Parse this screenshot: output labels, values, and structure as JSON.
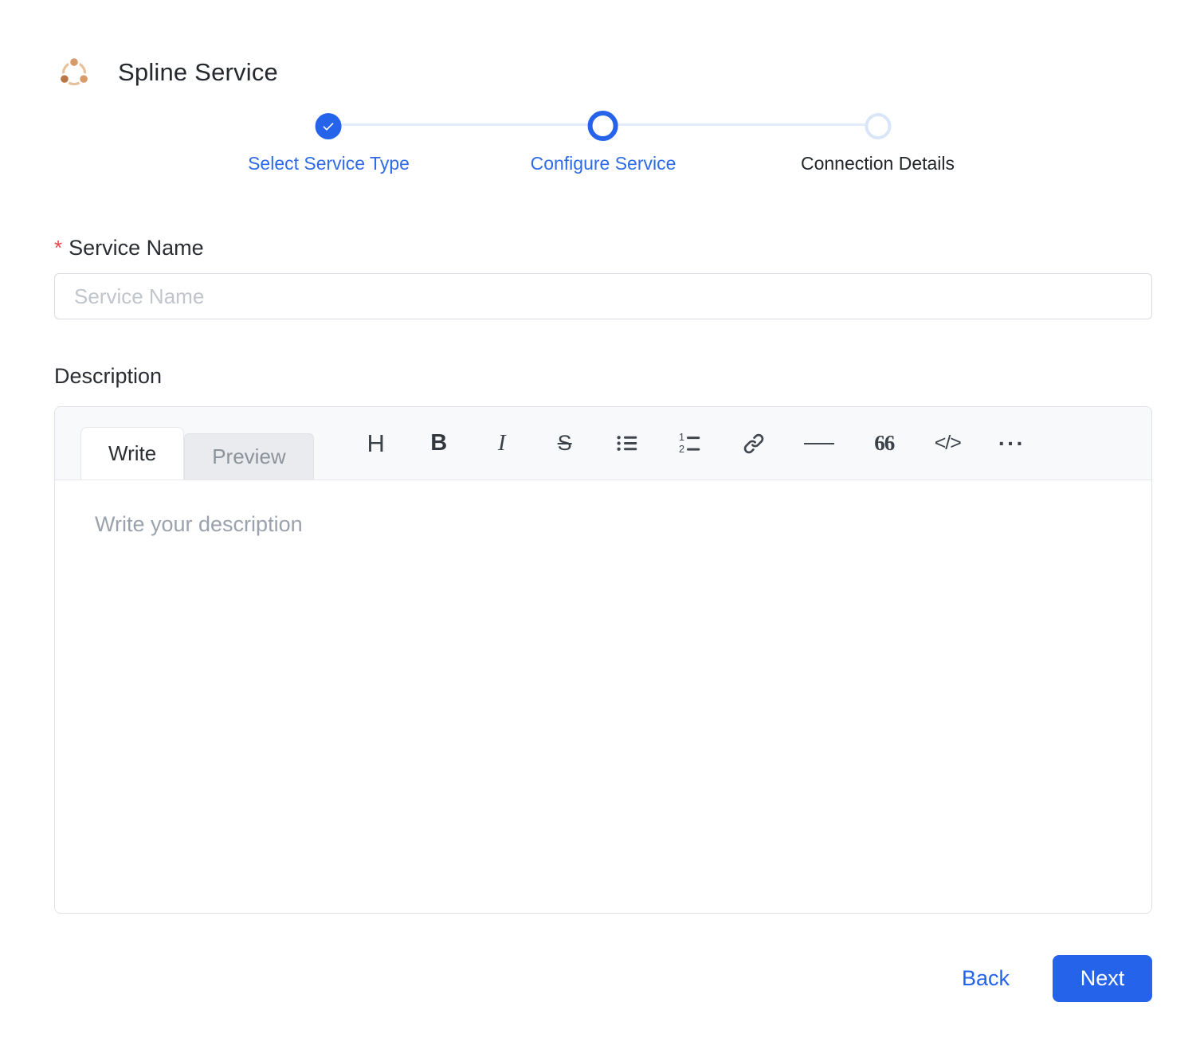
{
  "header": {
    "title": "Spline Service",
    "logo": "spline-network-icon"
  },
  "stepper": {
    "steps": [
      {
        "label": "Select Service Type",
        "state": "completed"
      },
      {
        "label": "Configure Service",
        "state": "active"
      },
      {
        "label": "Connection Details",
        "state": "upcoming"
      }
    ]
  },
  "form": {
    "service_name": {
      "label": "Service Name",
      "required_marker": "*",
      "value": "",
      "placeholder": "Service Name"
    },
    "description": {
      "label": "Description",
      "value": "",
      "placeholder": "Write your description",
      "tabs": [
        {
          "label": "Write",
          "active": true
        },
        {
          "label": "Preview",
          "active": false
        }
      ],
      "toolbar": [
        {
          "name": "heading",
          "glyph": "H"
        },
        {
          "name": "bold",
          "glyph": "B"
        },
        {
          "name": "italic",
          "glyph": "I"
        },
        {
          "name": "strikethrough",
          "glyph": "S"
        },
        {
          "name": "bullet-list"
        },
        {
          "name": "numbered-list"
        },
        {
          "name": "link"
        },
        {
          "name": "horizontal-rule"
        },
        {
          "name": "quote",
          "glyph": "66"
        },
        {
          "name": "code",
          "glyph": "</>"
        },
        {
          "name": "more",
          "glyph": "···"
        }
      ]
    }
  },
  "actions": {
    "back_label": "Back",
    "next_label": "Next"
  },
  "colors": {
    "accent_blue": "#2563eb",
    "step_track": "#e2ecfa",
    "logo_orange": "#d89a66",
    "required_red": "#e5484d"
  }
}
